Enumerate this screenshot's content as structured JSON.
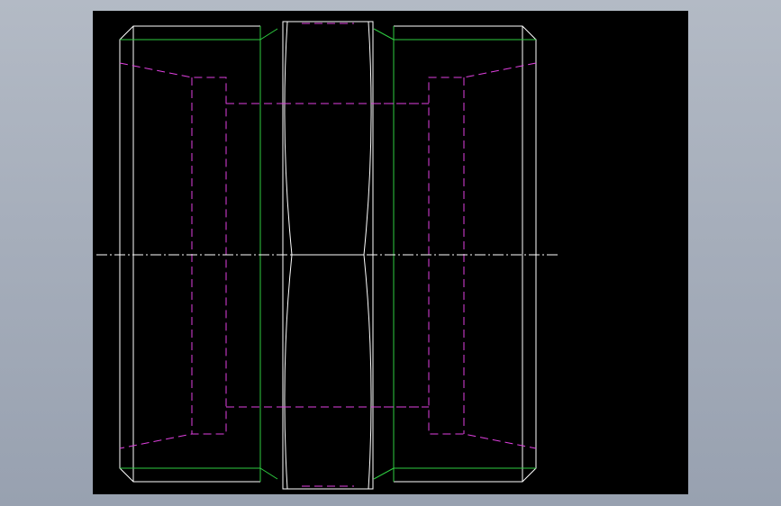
{
  "viewport": {
    "background_colors": [
      "#b3bac5",
      "#98a1b0"
    ],
    "canvas_color": "#000000"
  },
  "drawing": {
    "type": "cad-section-view",
    "colors": {
      "outline": "#ffffff",
      "chamfer_edges": "#2ecc40",
      "hidden_lines": "#e040e0",
      "center_line": "#ffffff"
    }
  }
}
